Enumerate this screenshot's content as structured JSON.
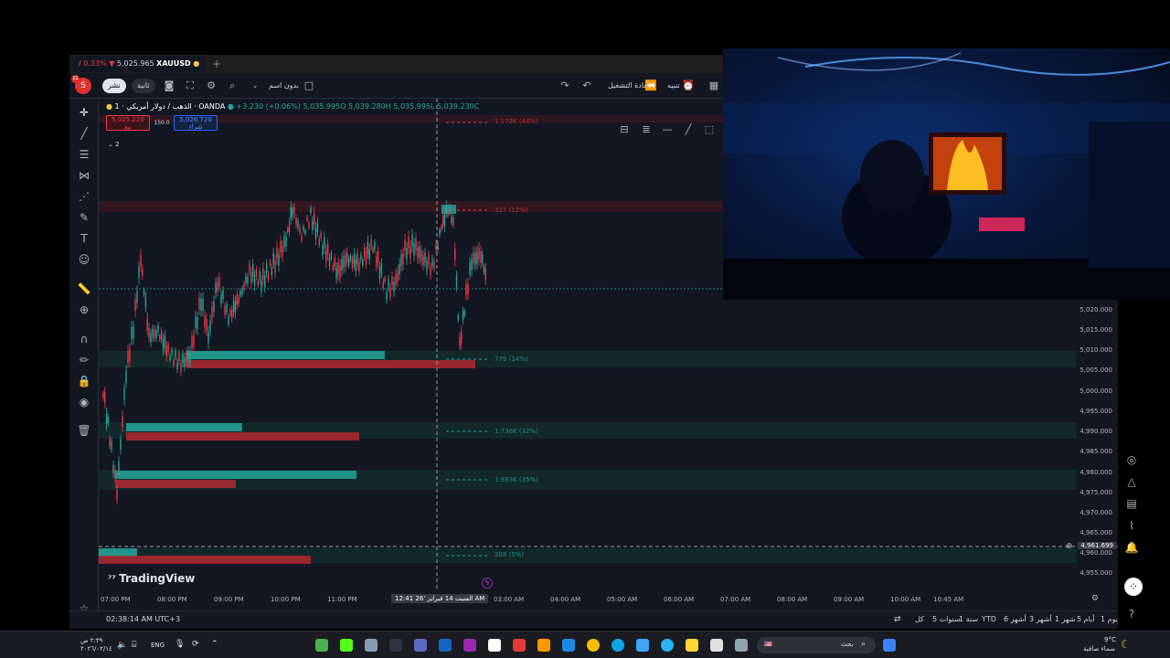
{
  "browser_tab": {
    "change": "0.33% ▼",
    "price": "5,025.965",
    "symbol": "XAUUSD"
  },
  "toolbar": {
    "avatar_letter": "S",
    "avatar_badge": "11",
    "share_label": "نشر",
    "timeframe_label": "ثانية",
    "indicators_label": "بدون اسم",
    "replay_label": "إعادة التشغيل",
    "alert_label": "تنبيه"
  },
  "legend": {
    "title": "الذهب / دولار أمريكي · 1 · OANDA",
    "change": "+3.230 (+0.06%)",
    "ohlc": "5,035.995O  5,039.280H  5,035.995L  5,039.230C",
    "sell_price": "5,025.220",
    "sell_label": "بيع",
    "spread": "150.0",
    "buy_price": "5,026.720",
    "buy_label": "شراء",
    "indicator_count": "2"
  },
  "volume_labels": [
    {
      "text": "1.172K (44%)",
      "color": "#f23645"
    },
    {
      "text": "327 (12%)",
      "color": "#f23645"
    },
    {
      "text": "779 (14%)",
      "color": "#26a69a"
    },
    {
      "text": "1.736K (32%)",
      "color": "#26a69a"
    },
    {
      "text": "1.883K (35%)",
      "color": "#26a69a"
    },
    {
      "text": "308 (5%)",
      "color": "#26a69a"
    }
  ],
  "price_scale": [
    "5,020.000",
    "5,015.000",
    "5,010.000",
    "5,005.000",
    "5,000.000",
    "4,995.000",
    "4,990.000",
    "4,985.000",
    "4,980.000",
    "4,975.000",
    "4,970.000",
    "4,965.000",
    "4,960.000",
    "4,955.000"
  ],
  "crosshair_price": "4,961.699",
  "time_axis": [
    "07:00 PM",
    "08:00 PM",
    "09:00 PM",
    "10:00 PM",
    "11:00 PM",
    "03:00 AM",
    "04:00 AM",
    "05:00 AM",
    "06:00 AM",
    "07:00 AM",
    "08:00 AM",
    "09:00 AM",
    "10:00 AM",
    "10:45 AM"
  ],
  "crosshair_time": "السبت 14 فبراير '26   12:41 AM",
  "logo": "TradingView",
  "bottom_bar": {
    "clock": "02:38:14 AM UTC+3",
    "ranges": [
      "يوم 1",
      "أيام 5",
      "شهر 1",
      "أشهر 3",
      "أشهر 6",
      "YTD",
      "سنة 1",
      "سنوات 5",
      "كل"
    ]
  },
  "taskbar": {
    "time": "‫‬٢:٣٩ ص",
    "date": "٢٠٢٦/٠٢/١٤",
    "lang": "ENG",
    "search_placeholder": "بحث",
    "weather_temp": "9°C",
    "weather_desc": "سماء صافية"
  }
}
